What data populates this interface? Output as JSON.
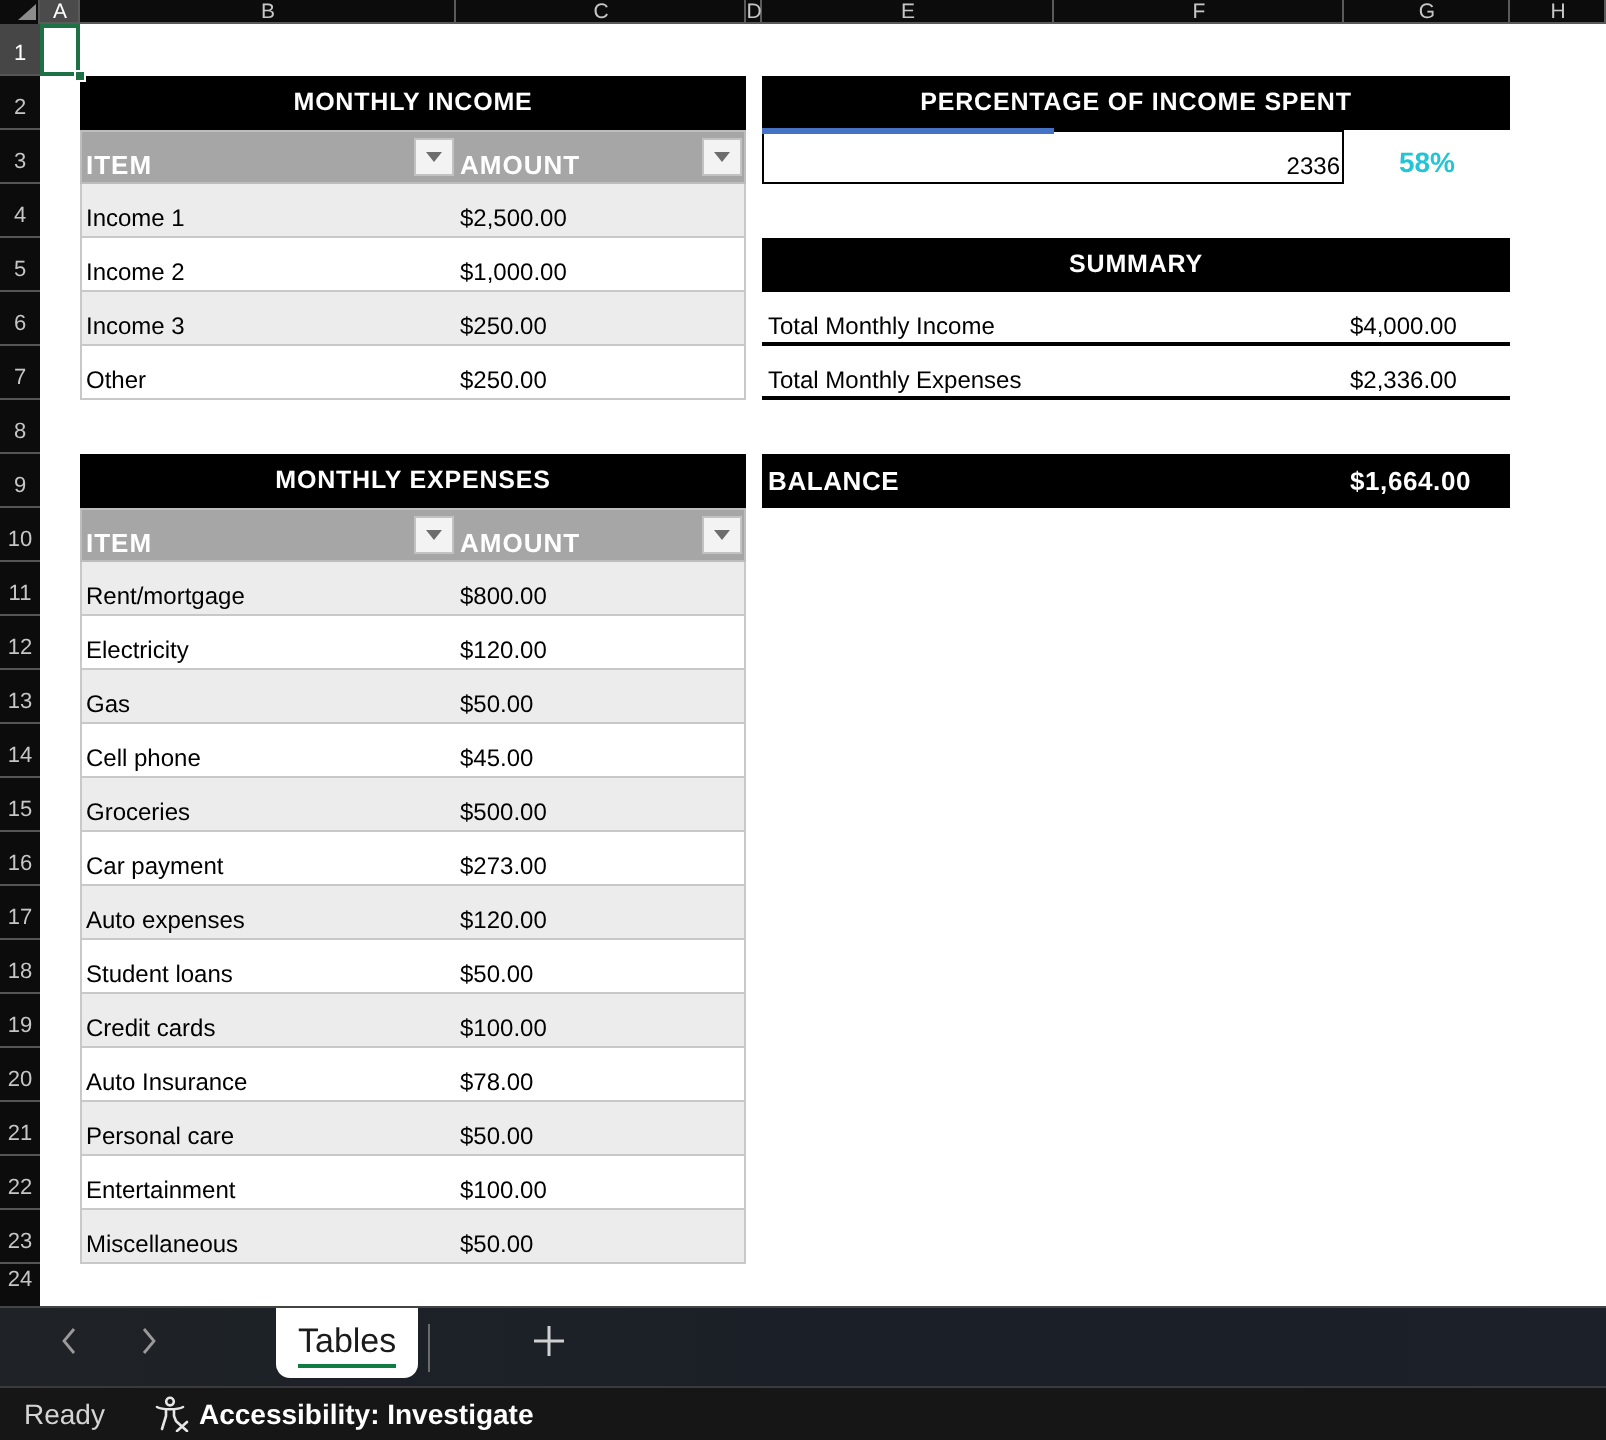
{
  "column_headers": [
    {
      "label": "A",
      "selected": true
    },
    {
      "label": "B",
      "selected": false
    },
    {
      "label": "C",
      "selected": false
    },
    {
      "label": "D",
      "selected": false
    },
    {
      "label": "E",
      "selected": false
    },
    {
      "label": "F",
      "selected": false
    },
    {
      "label": "G",
      "selected": false
    },
    {
      "label": "H",
      "selected": false
    }
  ],
  "row_headers": [
    {
      "label": "1",
      "selected": true
    },
    {
      "label": "2",
      "selected": false
    },
    {
      "label": "3",
      "selected": false
    },
    {
      "label": "4",
      "selected": false
    },
    {
      "label": "5",
      "selected": false
    },
    {
      "label": "6",
      "selected": false
    },
    {
      "label": "7",
      "selected": false
    },
    {
      "label": "8",
      "selected": false
    },
    {
      "label": "9",
      "selected": false
    },
    {
      "label": "10",
      "selected": false
    },
    {
      "label": "11",
      "selected": false
    },
    {
      "label": "12",
      "selected": false
    },
    {
      "label": "13",
      "selected": false
    },
    {
      "label": "14",
      "selected": false
    },
    {
      "label": "15",
      "selected": false
    },
    {
      "label": "16",
      "selected": false
    },
    {
      "label": "17",
      "selected": false
    },
    {
      "label": "18",
      "selected": false
    },
    {
      "label": "19",
      "selected": false
    },
    {
      "label": "20",
      "selected": false
    },
    {
      "label": "21",
      "selected": false
    },
    {
      "label": "22",
      "selected": false
    },
    {
      "label": "23",
      "selected": false
    },
    {
      "label": "24",
      "selected": false
    }
  ],
  "income_table": {
    "title": "MONTHLY INCOME",
    "columns": [
      "ITEM",
      "AMOUNT"
    ],
    "rows": [
      {
        "item": "Income 1",
        "amount": "$2,500.00"
      },
      {
        "item": "Income 2",
        "amount": "$1,000.00"
      },
      {
        "item": "Income 3",
        "amount": "$250.00"
      },
      {
        "item": "Other",
        "amount": "$250.00"
      }
    ]
  },
  "expense_table": {
    "title": "MONTHLY EXPENSES",
    "columns": [
      "ITEM",
      "AMOUNT"
    ],
    "rows": [
      {
        "item": "Rent/mortgage",
        "amount": "$800.00"
      },
      {
        "item": "Electricity",
        "amount": "$120.00"
      },
      {
        "item": "Gas",
        "amount": "$50.00"
      },
      {
        "item": "Cell phone",
        "amount": "$45.00"
      },
      {
        "item": "Groceries",
        "amount": "$500.00"
      },
      {
        "item": "Car payment",
        "amount": "$273.00"
      },
      {
        "item": "Auto expenses",
        "amount": "$120.00"
      },
      {
        "item": "Student loans",
        "amount": "$50.00"
      },
      {
        "item": "Credit cards",
        "amount": "$100.00"
      },
      {
        "item": "Auto Insurance",
        "amount": "$78.00"
      },
      {
        "item": "Personal care",
        "amount": "$50.00"
      },
      {
        "item": "Entertainment",
        "amount": "$100.00"
      },
      {
        "item": "Miscellaneous",
        "amount": "$50.00"
      }
    ]
  },
  "income_spent": {
    "title": "PERCENTAGE OF INCOME SPENT",
    "level": 0.5,
    "amount": "2336",
    "percent": "58%"
  },
  "summary": {
    "title": "SUMMARY",
    "rows": [
      {
        "label": "Total Monthly Income",
        "value": "$4,000.00"
      },
      {
        "label": "Total Monthly Expenses",
        "value": "$2,336.00"
      }
    ]
  },
  "balance": {
    "label": "BALANCE",
    "value": "$1,664.00"
  },
  "sheet_tabs": [
    {
      "label": "Tables",
      "selected": true
    }
  ],
  "status_bar": {
    "mode": "Ready",
    "accessibility": "Accessibility: Investigate"
  }
}
